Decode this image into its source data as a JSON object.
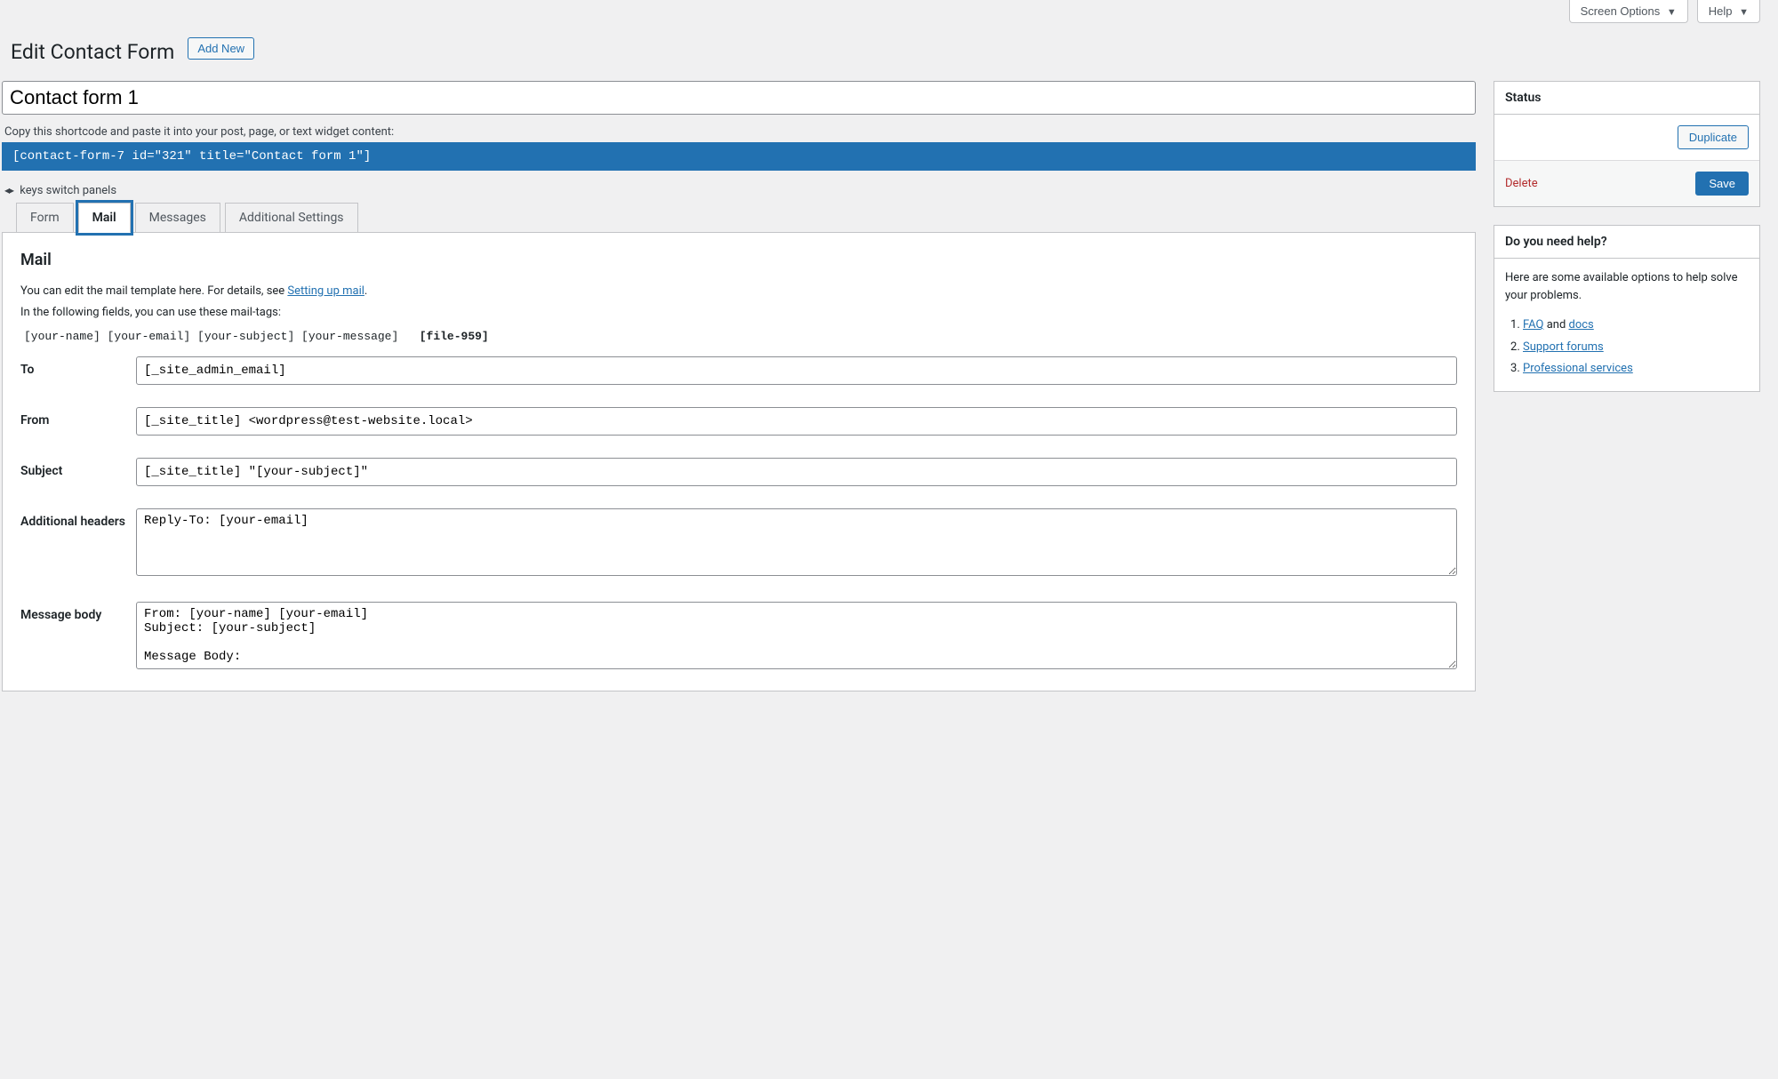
{
  "topPanel": {
    "screenOptions": "Screen Options",
    "help": "Help"
  },
  "header": {
    "title": "Edit Contact Form",
    "addNew": "Add New"
  },
  "form": {
    "titleValue": "Contact form 1",
    "shortcodeDesc": "Copy this shortcode and paste it into your post, page, or text widget content:",
    "shortcode": "[contact-form-7 id=\"321\" title=\"Contact form 1\"]",
    "switchHint": "keys switch panels"
  },
  "tabs": {
    "form": "Form",
    "mail": "Mail",
    "messages": "Messages",
    "additional": "Additional Settings"
  },
  "mailPanel": {
    "title": "Mail",
    "descPrefix": "You can edit the mail template here. For details, see ",
    "descLink": "Setting up mail",
    "descSuffix": ".",
    "tagsHint": "In the following fields, you can use these mail-tags:",
    "tags": "[your-name] [your-email] [your-subject] [your-message]",
    "tagsBold": "[file-959]",
    "labels": {
      "to": "To",
      "from": "From",
      "subject": "Subject",
      "additionalHeaders": "Additional headers",
      "messageBody": "Message body"
    },
    "values": {
      "to": "[_site_admin_email]",
      "from": "[_site_title] <wordpress@test-website.local>",
      "subject": "[_site_title] \"[your-subject]\"",
      "additionalHeaders": "Reply-To: [your-email]",
      "messageBody": "From: [your-name] [your-email]\nSubject: [your-subject]\n\nMessage Body:"
    }
  },
  "status": {
    "title": "Status",
    "duplicate": "Duplicate",
    "delete": "Delete",
    "save": "Save"
  },
  "help": {
    "title": "Do you need help?",
    "text": "Here are some available options to help solve your problems.",
    "faq": "FAQ",
    "and": " and ",
    "docs": "docs",
    "support": "Support forums",
    "professional": "Professional services"
  }
}
